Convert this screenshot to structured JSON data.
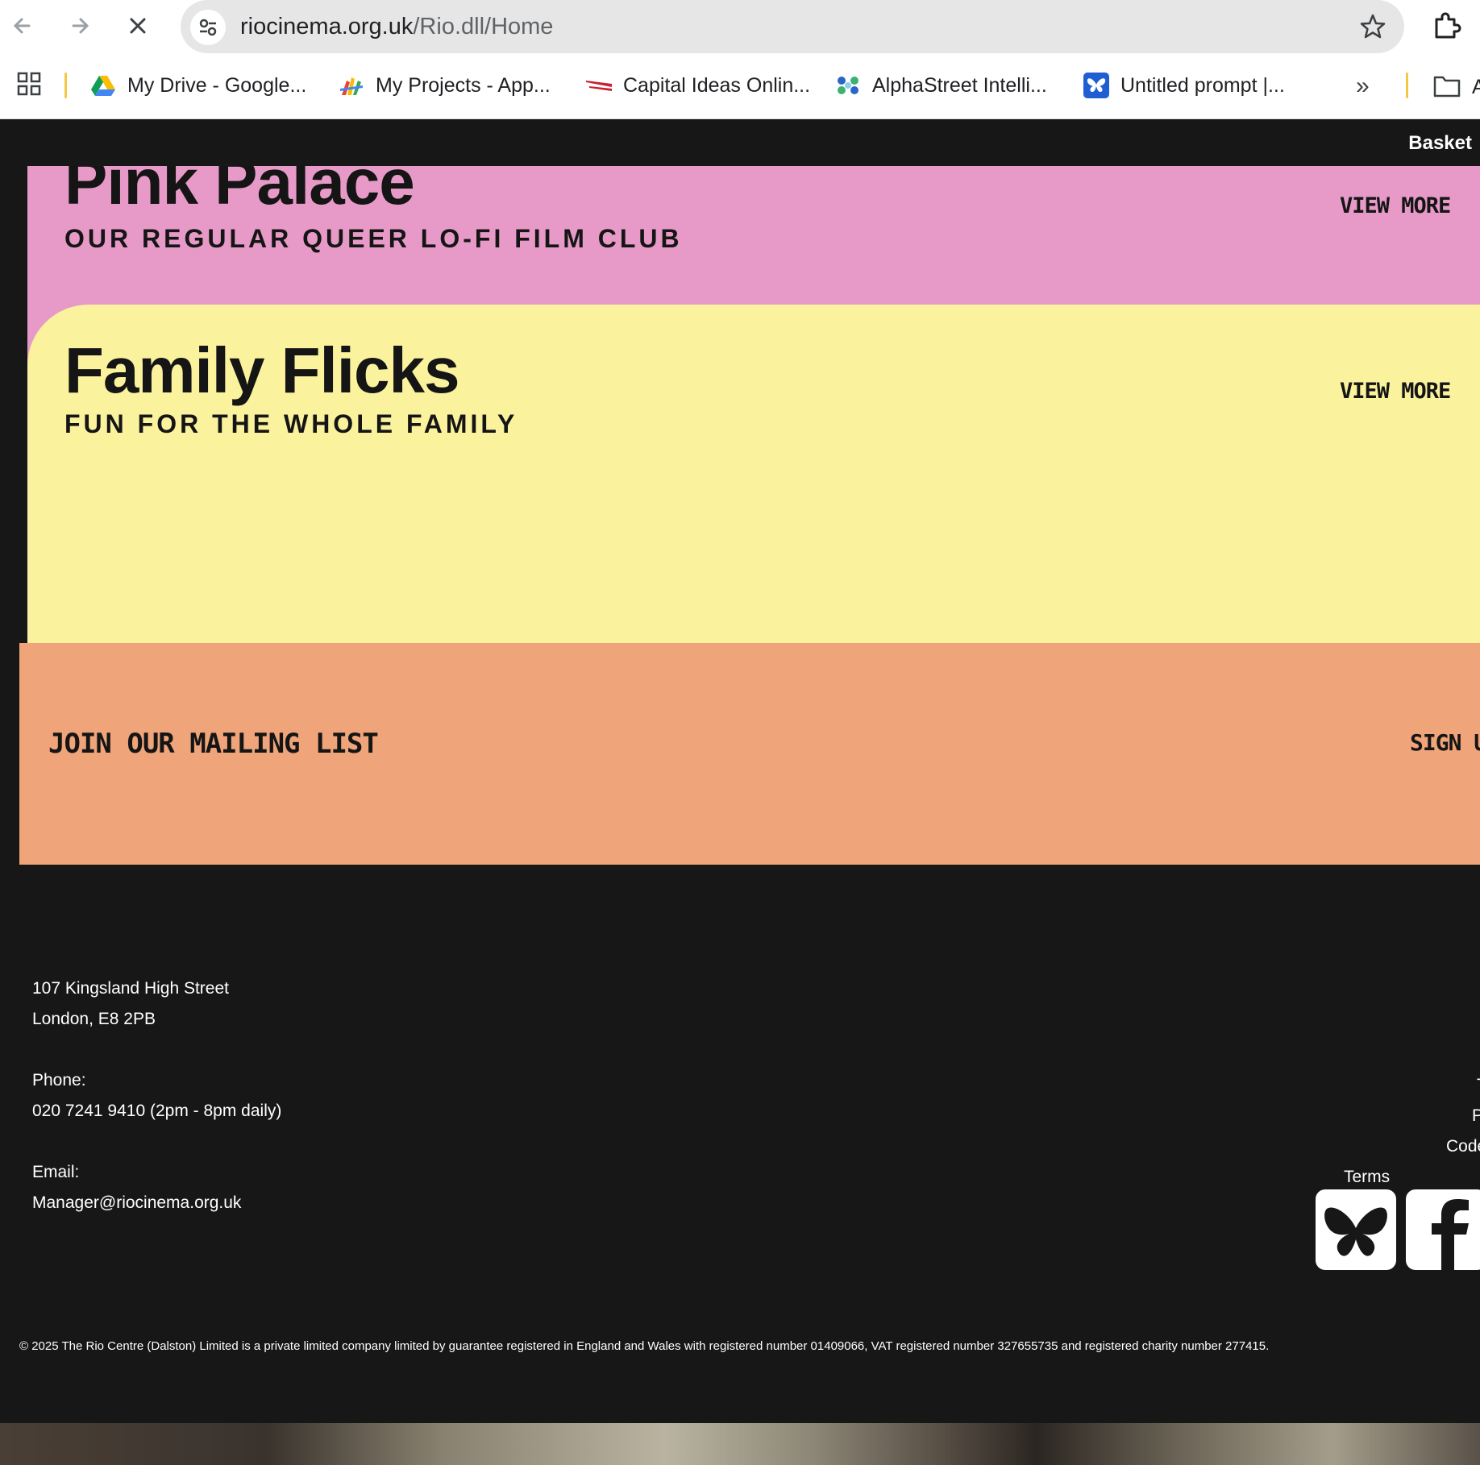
{
  "browser": {
    "url_host": "riocinema.org.uk",
    "url_path": "/Rio.dll/Home",
    "bookmarks": [
      {
        "label": "My Drive - Google...",
        "icon": "google-drive-icon"
      },
      {
        "label": "My Projects - App...",
        "icon": "appsheet-icon"
      },
      {
        "label": "Capital Ideas Onlin...",
        "icon": "capital-ideas-icon"
      },
      {
        "label": "AlphaStreet Intelli...",
        "icon": "alphastreet-icon"
      },
      {
        "label": "Untitled prompt |...",
        "icon": "butterfly-icon"
      }
    ],
    "folder_label": "A"
  },
  "header": {
    "basket_label": "Basket"
  },
  "cards": [
    {
      "title": "Pink Palace",
      "subtitle": "OUR REGULAR QUEER LO-FI FILM CLUB",
      "link": "VIEW MORE",
      "color": "#e79ac7"
    },
    {
      "title": "Family Flicks",
      "subtitle": "FUN FOR THE WHOLE FAMILY",
      "link": "VIEW MORE",
      "color": "#fbf29d"
    }
  ],
  "mailing": {
    "text": "JOIN OUR MAILING LIST",
    "link": "SIGN U",
    "color": "#efa47a"
  },
  "footer": {
    "address_line1": "107 Kingsland High Street",
    "address_line2": "London, E8 2PB",
    "phone_label": "Phone:",
    "phone_value": "020 7241 9410 (2pm - 8pm daily)",
    "email_label": "Email:",
    "email_value": "Manager@riocinema.org.uk",
    "right_links": [
      "T",
      "P",
      "Code",
      "Terms"
    ],
    "copyright": "© 2025 The Rio Centre (Dalston) Limited is a private limited company limited by guarantee registered in England and Wales with registered number 01409066, VAT registered number 327655735 and registered charity number 277415."
  }
}
